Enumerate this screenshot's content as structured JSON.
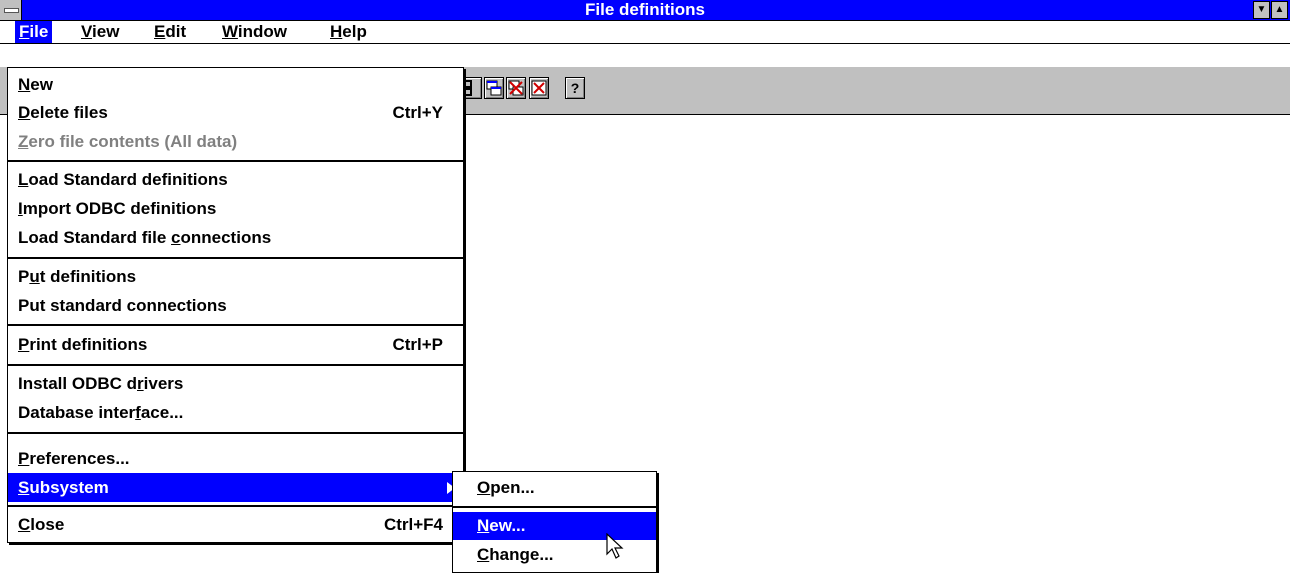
{
  "window": {
    "title": "File definitions"
  },
  "menubar": {
    "items": [
      {
        "mn": "F",
        "rest": "ile"
      },
      {
        "mn": "V",
        "rest": "iew"
      },
      {
        "mn": "E",
        "rest": "dit"
      },
      {
        "mn": "W",
        "rest": "indow"
      },
      {
        "mn": "H",
        "rest": "elp"
      }
    ]
  },
  "toolbar": {
    "buttons": [
      "block-icon",
      "windows-icon",
      "delete-window-icon",
      "close-x-icon",
      "help-icon"
    ],
    "help_glyph": "?"
  },
  "file_menu": {
    "items": [
      {
        "pre": "",
        "mn": "N",
        "post": "ew",
        "shortcut": ""
      },
      {
        "pre": "",
        "mn": "D",
        "post": "elete files",
        "shortcut": "Ctrl+Y"
      },
      {
        "pre": "",
        "mn": "Z",
        "post": "ero file contents (All data)",
        "shortcut": "",
        "disabled": true
      },
      {
        "pre": "",
        "mn": "L",
        "post": "oad Standard definitions",
        "shortcut": ""
      },
      {
        "pre": "",
        "mn": "I",
        "post": "mport ODBC definitions",
        "shortcut": ""
      },
      {
        "pre": "Load Standard file ",
        "mn": "c",
        "post": "onnections",
        "shortcut": ""
      },
      {
        "pre": "P",
        "mn": "u",
        "post": "t definitions",
        "shortcut": ""
      },
      {
        "pre": "Put standard connections",
        "mn": "",
        "post": "",
        "shortcut": ""
      },
      {
        "pre": "",
        "mn": "P",
        "post": "rint definitions",
        "shortcut": "Ctrl+P"
      },
      {
        "pre": "Install ODBC d",
        "mn": "r",
        "post": "ivers",
        "shortcut": ""
      },
      {
        "pre": "Database inter",
        "mn": "f",
        "post": "ace...",
        "shortcut": ""
      },
      {
        "pre": "",
        "mn": "P",
        "post": "references...",
        "shortcut": ""
      },
      {
        "pre": "",
        "mn": "S",
        "post": "ubsystem",
        "shortcut": "",
        "highlighted": true
      },
      {
        "pre": "",
        "mn": "C",
        "post": "lose",
        "shortcut": "Ctrl+F4"
      }
    ]
  },
  "submenu": {
    "items": [
      {
        "mn": "O",
        "post": "pen..."
      },
      {
        "mn": "N",
        "post": "ew...",
        "highlighted": true
      },
      {
        "mn": "C",
        "post": "hange..."
      }
    ]
  },
  "colors": {
    "accent": "#0000ff",
    "toolbar": "#c0c0c0",
    "disabled": "#808080"
  }
}
